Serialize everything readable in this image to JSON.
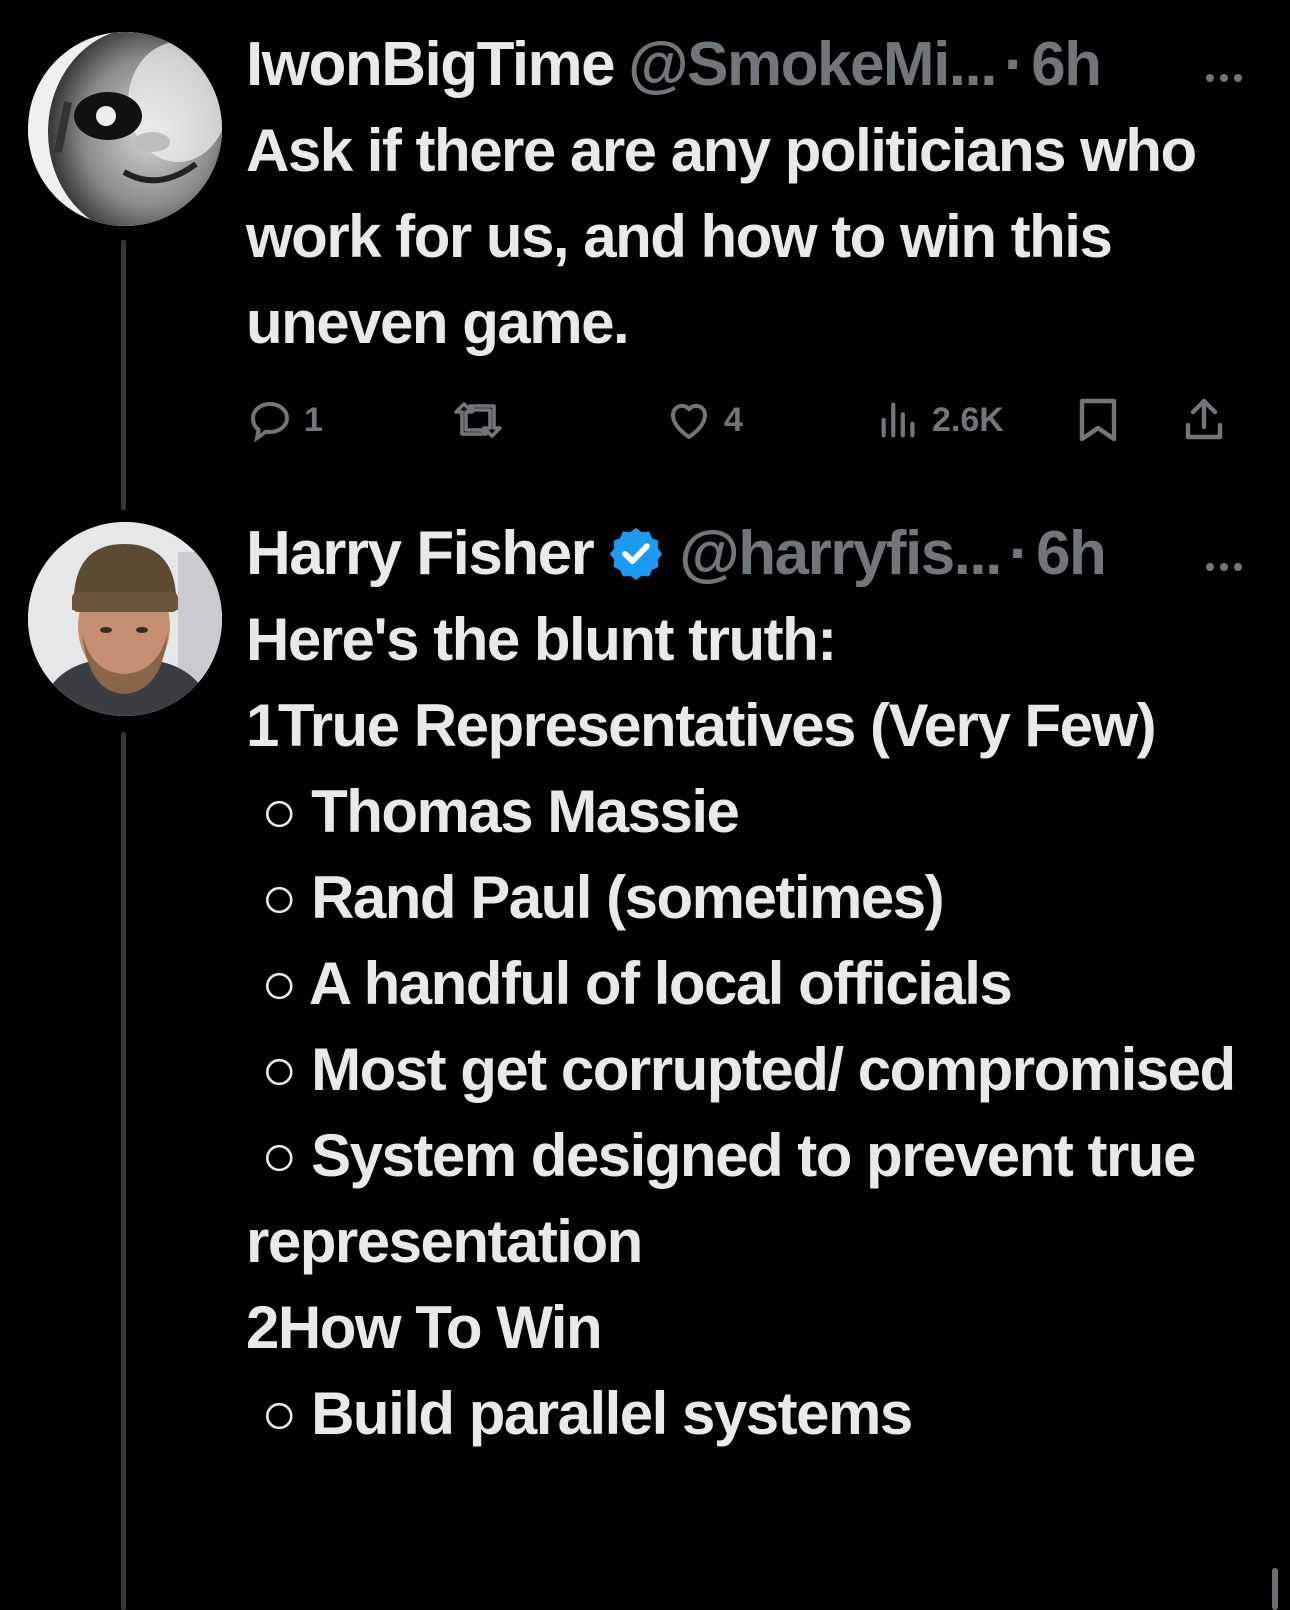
{
  "tweets": [
    {
      "display_name": "IwonBigTime",
      "handle": "@SmokeMi...",
      "separator": "·",
      "time": "6h",
      "verified": false,
      "text": "Ask if there are any politicians who work for us, and how to win this uneven game.",
      "actions": {
        "replies": "1",
        "reposts": "",
        "likes": "4",
        "views": "2.6K"
      }
    },
    {
      "display_name": "Harry Fisher",
      "handle": "@harryfis...",
      "separator": "·",
      "time": "6h",
      "verified": true,
      "text": "Here's the blunt truth:\n1True Representatives (Very Few)\n ○ Thomas Massie\n ○ Rand Paul (sometimes)\n ○ A handful of local officials\n ○ Most get corrupted/ compromised\n ○ System designed to prevent true representation\n2How To Win\n ○ Build parallel systems"
    }
  ],
  "colors": {
    "background": "#000000",
    "primary_text": "#e7e9ea",
    "secondary_text": "#71767b",
    "thread_line": "#333639",
    "verified_badge": "#1d9bf0"
  },
  "icons": {
    "more": "ellipsis-icon",
    "reply": "speech-bubble-icon",
    "repost": "repost-arrows-icon",
    "like": "heart-icon",
    "views": "bar-chart-icon",
    "bookmark": "bookmark-icon",
    "share": "share-upload-icon",
    "verified": "verified-check-badge-icon"
  }
}
